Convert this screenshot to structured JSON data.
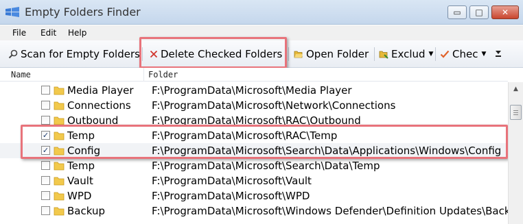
{
  "window": {
    "title": "Empty Folders Finder",
    "controls": {
      "minimize": "▭",
      "maximize": "□",
      "close": "✕"
    }
  },
  "menu": [
    "File",
    "Edit",
    "Help"
  ],
  "toolbar": {
    "scan_label": "Scan for Empty Folders",
    "delete_label": "Delete Checked Folders",
    "open_label": "Open Folder",
    "exclude_label": "Exclud",
    "check_label": "Chec",
    "overflow_icon": "chevron-double-down-icon"
  },
  "list": {
    "columns": {
      "name": "Name",
      "folder": "Folder"
    },
    "rows": [
      {
        "name": "Media Player",
        "path": "F:\\ProgramData\\Microsoft\\Media Player",
        "checked": false
      },
      {
        "name": "Connections",
        "path": "F:\\ProgramData\\Microsoft\\Network\\Connections",
        "checked": false
      },
      {
        "name": "Outbound",
        "path": "F:\\ProgramData\\Microsoft\\RAC\\Outbound",
        "checked": false
      },
      {
        "name": "Temp",
        "path": "F:\\ProgramData\\Microsoft\\RAC\\Temp",
        "checked": true
      },
      {
        "name": "Config",
        "path": "F:\\ProgramData\\Microsoft\\Search\\Data\\Applications\\Windows\\Config",
        "checked": true
      },
      {
        "name": "Temp",
        "path": "F:\\ProgramData\\Microsoft\\Search\\Data\\Temp",
        "checked": false
      },
      {
        "name": "Vault",
        "path": "F:\\ProgramData\\Microsoft\\Vault",
        "checked": false
      },
      {
        "name": "WPD",
        "path": "F:\\ProgramData\\Microsoft\\WPD",
        "checked": false
      },
      {
        "name": "Backup",
        "path": "F:\\ProgramData\\Microsoft\\Windows Defender\\Definition Updates\\Backup",
        "checked": false
      }
    ]
  },
  "colors": {
    "highlight": "#e8737b",
    "folder": "#f2c94c",
    "delete_x": "#d0342c"
  }
}
